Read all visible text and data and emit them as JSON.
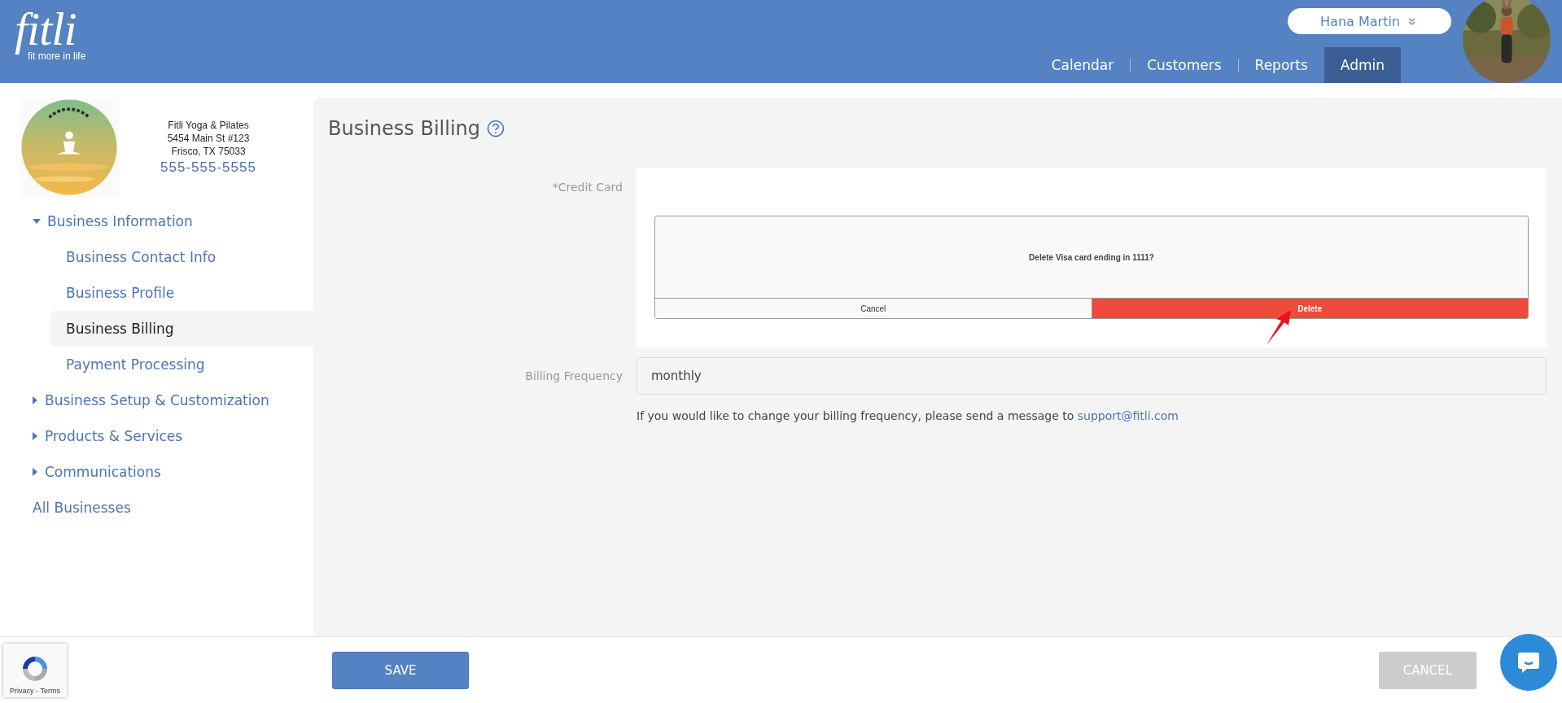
{
  "header": {
    "logo": "fitli",
    "tagline": "fit more in life",
    "user": "Hana Martin",
    "nav": [
      {
        "label": "Calendar",
        "selected": false
      },
      {
        "label": "Customers",
        "selected": false
      },
      {
        "label": "Reports",
        "selected": false
      },
      {
        "label": "Admin",
        "selected": true
      }
    ]
  },
  "business": {
    "name": "Fitli Yoga & Pilates",
    "address": "5454 Main St #123",
    "city": "Frisco, TX 75033",
    "phone": "555-555-5555"
  },
  "sidebar": [
    {
      "label": "Business Information",
      "expanded": true,
      "children": [
        {
          "label": "Business Contact Info",
          "selected": false
        },
        {
          "label": "Business Profile",
          "selected": false
        },
        {
          "label": "Business Billing",
          "selected": true
        },
        {
          "label": "Payment Processing",
          "selected": false
        }
      ]
    },
    {
      "label": "Business Setup & Customization",
      "expanded": false
    },
    {
      "label": "Products & Services",
      "expanded": false
    },
    {
      "label": "Communications",
      "expanded": false
    },
    {
      "label": "All Businesses"
    }
  ],
  "page": {
    "title": "Business Billing",
    "credit_card_label": "*Credit Card",
    "dialog": {
      "message": "Delete Visa card ending in 1111?",
      "cancel": "Cancel",
      "confirm": "Delete"
    },
    "frequency_label": "Billing Frequency",
    "frequency_value": "monthly",
    "help_text": "If you would like to change your billing frequency, please send a message to",
    "help_link": "support@fitli.com"
  },
  "footer": {
    "save": "SAVE",
    "cancel": "CANCEL"
  },
  "recaptcha": "Privacy - Terms"
}
